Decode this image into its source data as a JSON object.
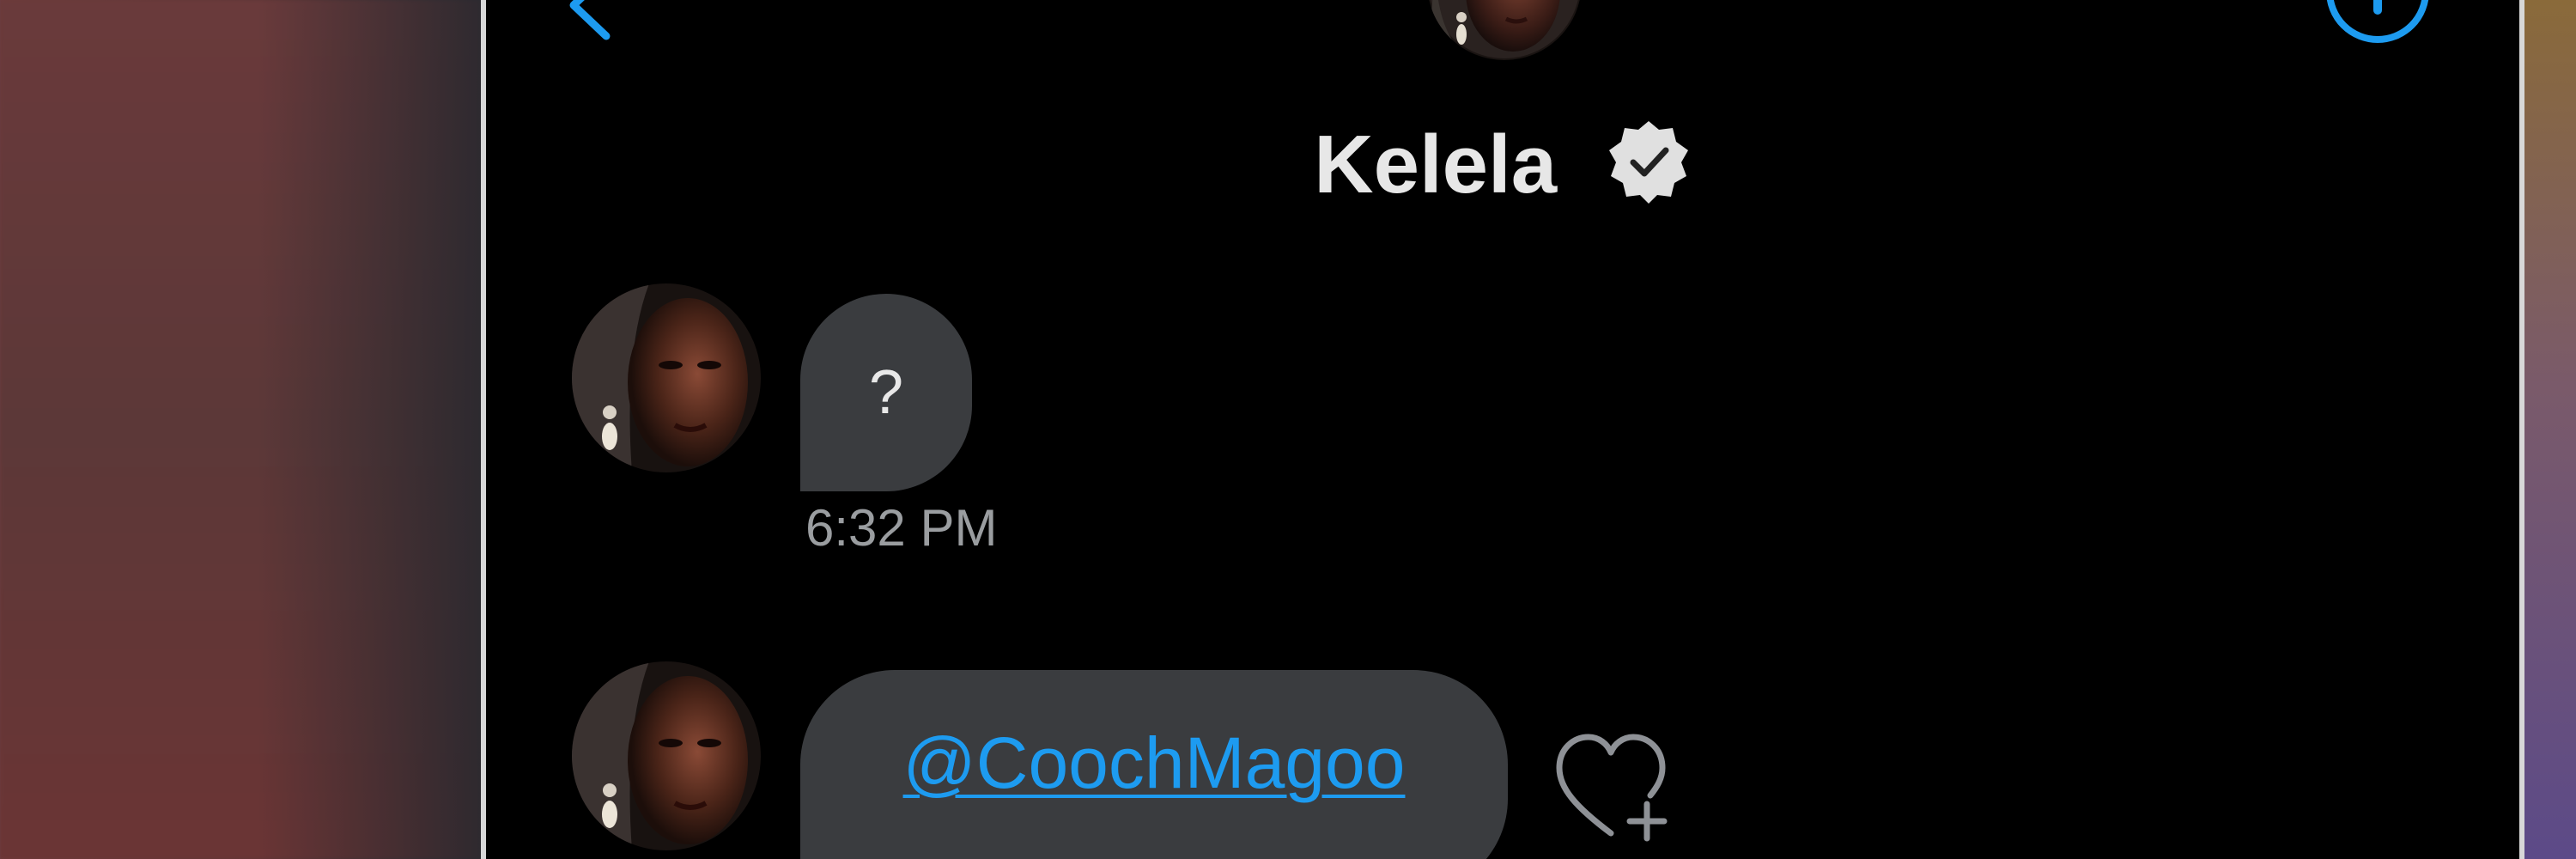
{
  "header": {
    "contact_name": "Kelela",
    "back_icon": "chevron-left-icon",
    "info_icon": "info-icon",
    "verified_icon": "verified-badge-icon",
    "accent_color": "#1d9bf0"
  },
  "messages": [
    {
      "sender": "Kelela",
      "text": "?",
      "time": "6:32 PM"
    },
    {
      "sender": "Kelela",
      "text": "@CoochMagoo",
      "reaction_icon": "heart-plus-icon"
    }
  ]
}
